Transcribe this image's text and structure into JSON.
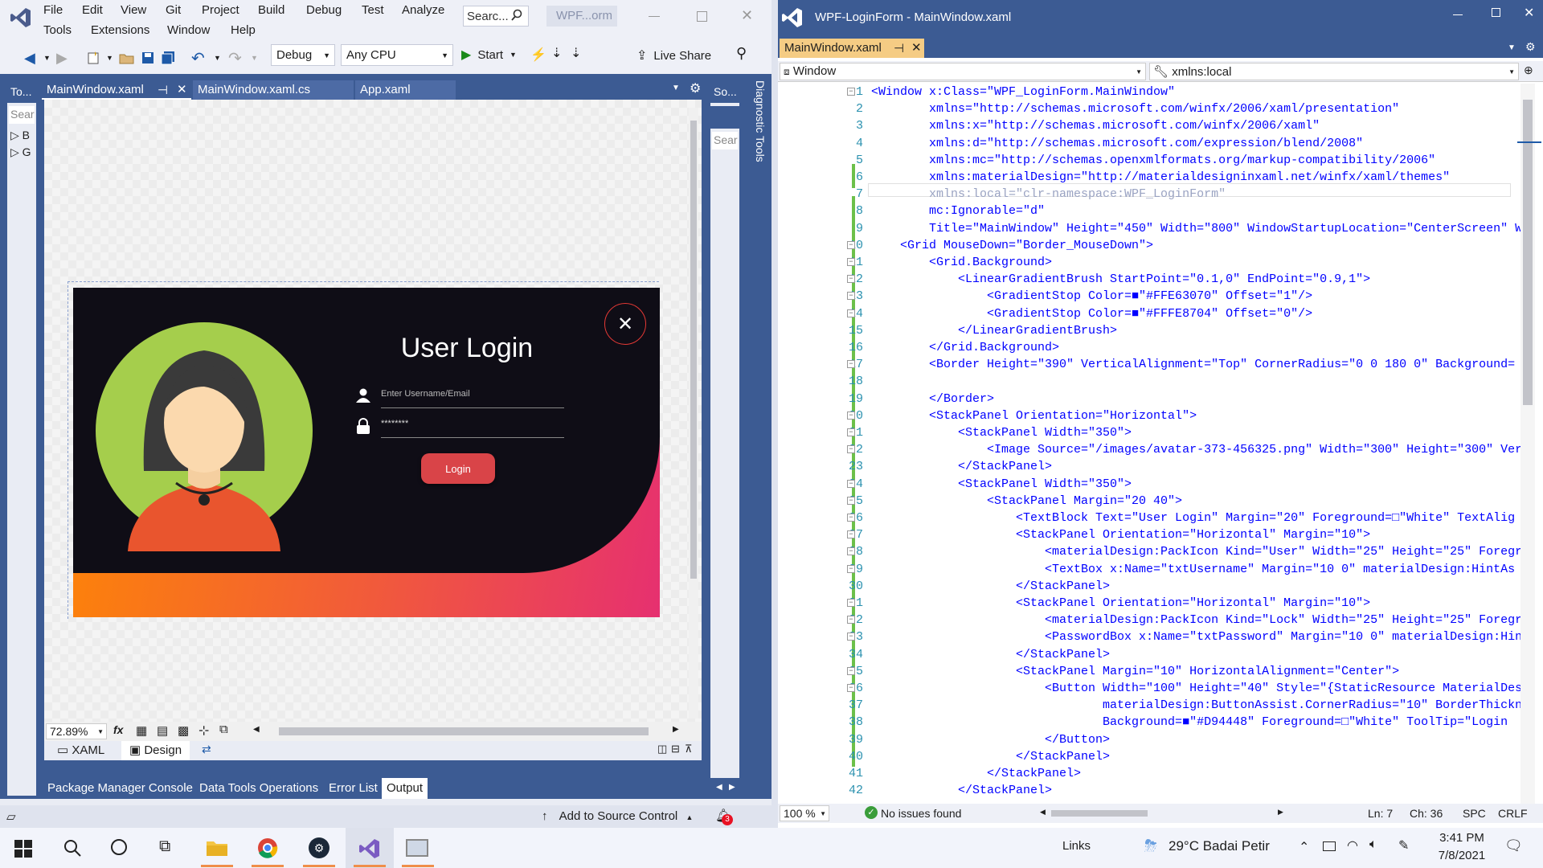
{
  "left": {
    "menu": [
      "File",
      "Edit",
      "View",
      "Git",
      "Project",
      "Build",
      "Debug",
      "Test",
      "Analyze"
    ],
    "menu2": [
      "Tools",
      "Extensions",
      "Window",
      "Help"
    ],
    "search_placeholder": "Searc...",
    "window_title": "WPF...orm",
    "toolbar": {
      "config": "Debug",
      "platform": "Any CPU",
      "start": "Start",
      "live_share": "Live Share"
    },
    "side_tab_toolbox": "To...",
    "side_search": "Sear",
    "side_items": [
      "B",
      "G"
    ],
    "doc_tabs": [
      "MainWindow.xaml",
      "MainWindow.xaml.cs",
      "App.xaml"
    ],
    "right_side_tab": "So...",
    "right_search": "Sear",
    "diag_tools": "Diagnostic Tools",
    "zoom": "72.89%",
    "fx": "fx",
    "view_tabs": [
      "XAML",
      "Design"
    ],
    "output_tabs": [
      "Package Manager Console",
      "Data Tools Operations",
      "Error List",
      "Output"
    ],
    "output_title": "Output",
    "source_control": "Add to Source Control",
    "notif_count": "3"
  },
  "form": {
    "title": "User Login",
    "username_placeholder": "Enter Username/Email",
    "password_value": "********",
    "login_button": "Login",
    "colors": {
      "dark": "#0F0D16",
      "gradient_start": "#FE8704",
      "gradient_end": "#E63070",
      "button": "#D94448",
      "avatar_bg": "#A5CE4C"
    }
  },
  "right": {
    "title": "WPF-LoginForm - MainWindow.xaml",
    "tab": "MainWindow.xaml",
    "nav_left": "Window",
    "nav_right": "xmlns:local",
    "zoom": "100 %",
    "issues": "No issues found",
    "ln": "Ln: 7",
    "ch": "Ch: 36",
    "spc": "SPC",
    "crlf": "CRLF",
    "line_numbers": [
      "1",
      "2",
      "3",
      "4",
      "5",
      "6",
      "7",
      "8",
      "9",
      "10",
      "11",
      "12",
      "13",
      "14",
      "15",
      "16",
      "17",
      "18",
      "19",
      "20",
      "21",
      "22",
      "23",
      "24",
      "25",
      "26",
      "27",
      "28",
      "29",
      "30",
      "31",
      "32",
      "33",
      "34",
      "35",
      "36",
      "37",
      "38",
      "39",
      "40",
      "41",
      "42"
    ],
    "code_lines": [
      "<Window x:Class=\"WPF_LoginForm.MainWindow\"",
      "        xmlns=\"http://schemas.microsoft.com/winfx/2006/xaml/presentation\"",
      "        xmlns:x=\"http://schemas.microsoft.com/winfx/2006/xaml\"",
      "        xmlns:d=\"http://schemas.microsoft.com/expression/blend/2008\"",
      "        xmlns:mc=\"http://schemas.openxmlformats.org/markup-compatibility/2006\"",
      "        xmlns:materialDesign=\"http://materialdesigninxaml.net/winfx/xaml/themes\"",
      "        xmlns:local=\"clr-namespace:WPF_LoginForm\"",
      "        mc:Ignorable=\"d\"",
      "        Title=\"MainWindow\" Height=\"450\" Width=\"800\" WindowStartupLocation=\"CenterScreen\" W",
      "    <Grid MouseDown=\"Border_MouseDown\">",
      "        <Grid.Background>",
      "            <LinearGradientBrush StartPoint=\"0.1,0\" EndPoint=\"0.9,1\">",
      "                <GradientStop Color=■\"#FFE63070\" Offset=\"1\"/>",
      "                <GradientStop Color=■\"#FFFE8704\" Offset=\"0\"/>",
      "            </LinearGradientBrush>",
      "        </Grid.Background>",
      "        <Border Height=\"390\" VerticalAlignment=\"Top\" CornerRadius=\"0 0 180 0\" Background=",
      "",
      "        </Border>",
      "        <StackPanel Orientation=\"Horizontal\">",
      "            <StackPanel Width=\"350\">",
      "                <Image Source=\"/images/avatar-373-456325.png\" Width=\"300\" Height=\"300\" Ver",
      "            </StackPanel>",
      "            <StackPanel Width=\"350\">",
      "                <StackPanel Margin=\"20 40\">",
      "                    <TextBlock Text=\"User Login\" Margin=\"20\" Foreground=□\"White\" TextAlig",
      "                    <StackPanel Orientation=\"Horizontal\" Margin=\"10\">",
      "                        <materialDesign:PackIcon Kind=\"User\" Width=\"25\" Height=\"25\" Foregr",
      "                        <TextBox x:Name=\"txtUsername\" Margin=\"10 0\" materialDesign:HintAs",
      "                    </StackPanel>",
      "                    <StackPanel Orientation=\"Horizontal\" Margin=\"10\">",
      "                        <materialDesign:PackIcon Kind=\"Lock\" Width=\"25\" Height=\"25\" Foregr",
      "                        <PasswordBox x:Name=\"txtPassword\" Margin=\"10 0\" materialDesign:Hin",
      "                    </StackPanel>",
      "                    <StackPanel Margin=\"10\" HorizontalAlignment=\"Center\">",
      "                        <Button Width=\"100\" Height=\"40\" Style=\"{StaticResource MaterialDes",
      "                                materialDesign:ButtonAssist.CornerRadius=\"10\" BorderThickn",
      "                                Background=■\"#D94448\" Foreground=□\"White\" ToolTip=\"Login",
      "                        </Button>",
      "                    </StackPanel>",
      "                </StackPanel>",
      "            </StackPanel>"
    ]
  },
  "taskbar": {
    "links": "Links",
    "weather": "29°C  Badai Petir",
    "time": "3:41 PM",
    "date": "7/8/2021"
  }
}
